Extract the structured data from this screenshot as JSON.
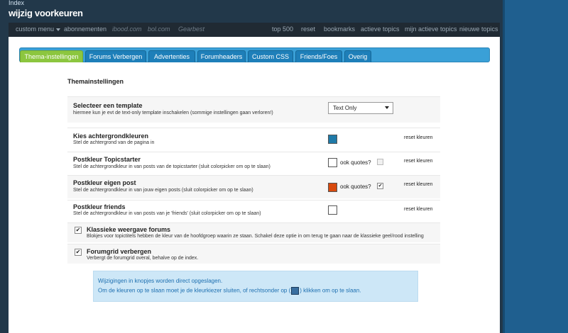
{
  "header": {
    "crumb": "Index",
    "title": "wijzig voorkeuren"
  },
  "navbar": {
    "left": [
      "custom menu",
      "abonnementen",
      "ibood.com",
      "bol.com",
      "Gearbest"
    ],
    "right": [
      "top 500",
      "reset",
      "bookmarks",
      "actieve topics",
      "mijn actieve topics",
      "nieuwe topics"
    ]
  },
  "tabs": [
    "Thema-instellingen",
    "Forums Verbergen",
    "Advertenties",
    "Forumheaders",
    "Custom CSS",
    "Friends/Foes",
    "Overig"
  ],
  "section_title": "Themainstellingen",
  "template": {
    "label": "Selecteer een template",
    "desc": "hiermee kun je evt de text-only template inschakelen (sommige instellingen gaan verloren!)",
    "value": "Text Only"
  },
  "colors": [
    {
      "label": "Kies achtergrondkleuren",
      "desc": "Stel de achtergrond van de pagina in",
      "color": "#1f7aa8",
      "quotes": "",
      "quotes_checked": false,
      "reset": "reset kleuren"
    },
    {
      "label": "Postkleur Topicstarter",
      "desc": "Stel de achtergrondkleur in van posts van de topicstarter (sluit colorpicker om op te slaan)",
      "color": "#ffffff",
      "quotes": "ook quotes?",
      "quotes_checked": false,
      "reset": "reset kleuren"
    },
    {
      "label": "Postkleur eigen post",
      "desc": "Stel de achtergrondkleur in van jouw eigen posts (sluit colorpicker om op te slaan)",
      "color": "#d84a0e",
      "quotes": "ook quotes?",
      "quotes_checked": true,
      "reset": "reset kleuren"
    },
    {
      "label": "Postkleur friends",
      "desc": "Stel de achtergrondkleur in van posts van je 'friends' (sluit colorpicker om op te slaan)",
      "color": "#ffffff",
      "quotes": "",
      "quotes_checked": false,
      "reset": "reset kleuren"
    }
  ],
  "options": [
    {
      "label": "Klassieke weergave forums",
      "desc": "Blokjes voor topictitels hebben de kleur van de hoofdgroep waarin ze staan. Schakel deze optie in om terug te gaan naar de klassieke geel/rood instelling",
      "checked": true
    },
    {
      "label": "Forumgrid verbergen",
      "desc": "Verbergt de forumgrid overal, behalve op de index.",
      "checked": true
    }
  ],
  "info": {
    "line1": "Wijzigingen in knopjes worden direct opgeslagen.",
    "line2a": "Om de kleuren op te slaan moet je de kleurkiezer sluiten, of rechtsonder op (",
    "line2b": ") klikken om op te slaan."
  }
}
